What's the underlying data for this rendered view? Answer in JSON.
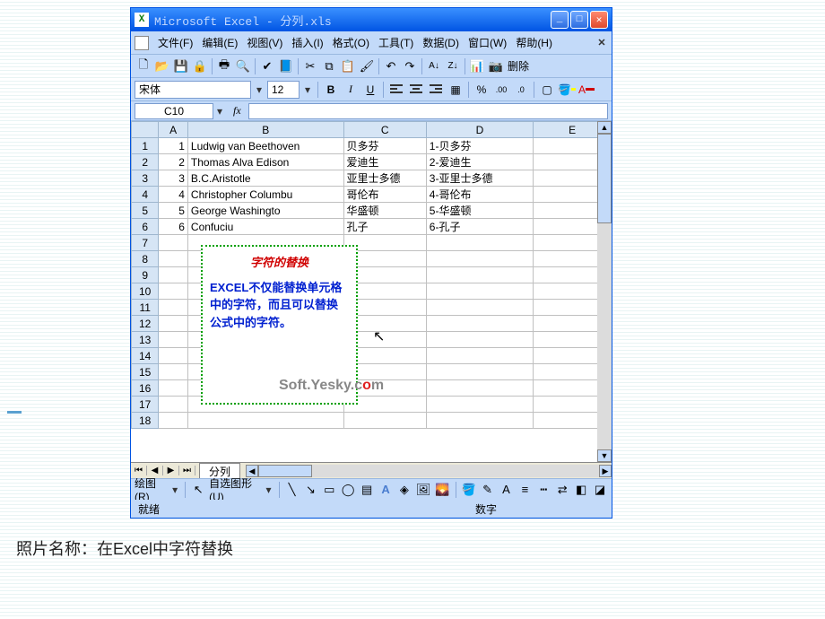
{
  "window": {
    "title": "Microsoft Excel - 分列.xls"
  },
  "menus": {
    "file": "文件(F)",
    "edit": "编辑(E)",
    "view": "视图(V)",
    "insert": "插入(I)",
    "format": "格式(O)",
    "tools": "工具(T)",
    "data": "数据(D)",
    "window": "窗口(W)",
    "help": "帮助(H)"
  },
  "toolbar": {
    "delete_label": "删除"
  },
  "format": {
    "font_name": "宋体",
    "font_size": "12"
  },
  "namebox": {
    "cell_ref": "C10",
    "fx_label": "fx"
  },
  "columns": [
    "A",
    "B",
    "C",
    "D",
    "E"
  ],
  "rows": [
    {
      "n": "1",
      "A": "1",
      "B": "Ludwig van Beethoven",
      "C": "贝多芬",
      "D": "1-贝多芬",
      "E": ""
    },
    {
      "n": "2",
      "A": "2",
      "B": "Thomas Alva Edison",
      "C": "爱迪生",
      "D": "2-爱迪生",
      "E": ""
    },
    {
      "n": "3",
      "A": "3",
      "B": "B.C.Aristotle",
      "C": "亚里士多德",
      "D": "3-亚里士多德",
      "E": ""
    },
    {
      "n": "4",
      "A": "4",
      "B": "Christopher Columbu",
      "C": "哥伦布",
      "D": "4-哥伦布",
      "E": ""
    },
    {
      "n": "5",
      "A": "5",
      "B": "George Washingto",
      "C": "华盛顿",
      "D": "5-华盛顿",
      "E": ""
    },
    {
      "n": "6",
      "A": "6",
      "B": "Confuciu",
      "C": "孔子",
      "D": "6-孔子",
      "E": ""
    },
    {
      "n": "7",
      "A": "",
      "B": "",
      "C": "",
      "D": "",
      "E": ""
    },
    {
      "n": "8",
      "A": "",
      "B": "",
      "C": "",
      "D": "",
      "E": ""
    },
    {
      "n": "9",
      "A": "",
      "B": "",
      "C": "",
      "D": "",
      "E": ""
    },
    {
      "n": "10",
      "A": "",
      "B": "",
      "C": "",
      "D": "",
      "E": ""
    },
    {
      "n": "11",
      "A": "",
      "B": "",
      "C": "",
      "D": "",
      "E": ""
    },
    {
      "n": "12",
      "A": "",
      "B": "",
      "C": "",
      "D": "",
      "E": ""
    },
    {
      "n": "13",
      "A": "",
      "B": "",
      "C": "",
      "D": "",
      "E": ""
    },
    {
      "n": "14",
      "A": "",
      "B": "",
      "C": "",
      "D": "",
      "E": ""
    },
    {
      "n": "15",
      "A": "",
      "B": "",
      "C": "",
      "D": "",
      "E": ""
    },
    {
      "n": "16",
      "A": "",
      "B": "",
      "C": "",
      "D": "",
      "E": ""
    },
    {
      "n": "17",
      "A": "",
      "B": "",
      "C": "",
      "D": "",
      "E": ""
    },
    {
      "n": "18",
      "A": "",
      "B": "",
      "C": "",
      "D": "",
      "E": ""
    }
  ],
  "callout": {
    "heading": "字符的替换",
    "body": "EXCEL不仅能替换单元格中的字符，而且可以替换公式中的字符。"
  },
  "watermark": {
    "pre": "Soft.Yesky.c",
    "mid": "o",
    "post": "m"
  },
  "sheet": {
    "tab_name": "分列"
  },
  "drawbar": {
    "draw_label": "绘图(R)",
    "autoshapes_label": "自选图形(U)"
  },
  "status": {
    "ready": "就绪",
    "numlock": "数字"
  },
  "caption": "照片名称：在Excel中字符替换"
}
